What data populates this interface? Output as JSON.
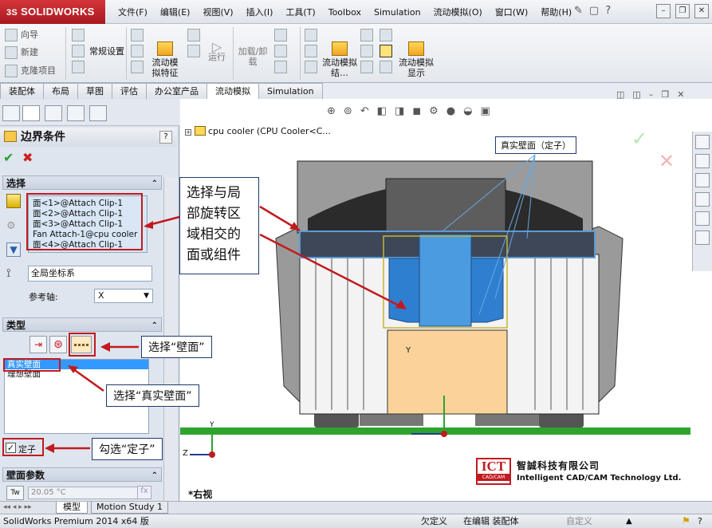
{
  "app": {
    "logo_text": "SOLIDWORKS",
    "logo_prefix": "3S"
  },
  "menu": [
    "文件(F)",
    "编辑(E)",
    "视图(V)",
    "插入(I)",
    "工具(T)",
    "Toolbox",
    "Simulation",
    "流动模拟(O)",
    "窗口(W)",
    "帮助(H)"
  ],
  "commands": {
    "wizard": "向导",
    "new": "新建",
    "clone": "克隆项目",
    "general_settings": "常规设置",
    "flow_features": "流动模拟特征",
    "run": "运行",
    "load_unload": "加载/卸载",
    "flow_results": "流动模拟结…",
    "flow_display": "流动模拟显示"
  },
  "tabs": [
    "装配体",
    "布局",
    "草图",
    "评估",
    "办公室产品",
    "流动模拟",
    "Simulation"
  ],
  "active_tab": "流动模拟",
  "panel": {
    "title": "边界条件",
    "help": "?",
    "selection_header": "选择",
    "selection_items": [
      "面<1>@Attach Clip-1",
      "面<2>@Attach Clip-1",
      "面<3>@Attach Clip-1",
      "Fan Attach-1@cpu cooler",
      "面<4>@Attach Clip-1"
    ],
    "coord_system": "全局坐标系",
    "ref_axis_label": "参考轴:",
    "ref_axis_value": "X",
    "type_header": "类型",
    "type_items": [
      "真实壁面",
      "理想壁面"
    ],
    "stator_label": "定子",
    "stator_checked": true,
    "wall_params_header": "壁面参数",
    "temperature_value": "20.05 °C",
    "temp_icon_label": "Tw"
  },
  "viewport": {
    "tree_root": "cpu cooler  (CPU Cooler<C...",
    "view_label": "*右视",
    "axis_y": "Y",
    "axis_z": "Z"
  },
  "callouts": {
    "real_wall_stator": "真实壁面（定子）",
    "select_faces": "选择与局部旋转区域相交的面或组件",
    "select_faces_lines": [
      "选择与局",
      "部旋转区",
      "域相交的",
      "面或组件"
    ],
    "select_wall": "选择“壁面”",
    "select_real_wall": "选择“真实壁面”",
    "check_stator": "勾选“定子”"
  },
  "watermark": {
    "ict": "ICT",
    "ict_sub": "CAD/CAM",
    "company_cn": "智誠科技有限公司",
    "company_en": "Intelligent CAD/CAM Technology Ltd."
  },
  "bottom_tabs": [
    "模型",
    "Motion Study 1"
  ],
  "status": {
    "product": "SolidWorks Premium 2014 x64 版",
    "under_defined": "欠定义",
    "editing": "在编辑 装配体",
    "custom": "自定义"
  },
  "colors": {
    "brand_red": "#c11a1f",
    "selection_blue": "#3399ff",
    "ground_green": "#2ea32e",
    "copper": "#fbd39a",
    "flow_blue": "#2f7fd0"
  }
}
